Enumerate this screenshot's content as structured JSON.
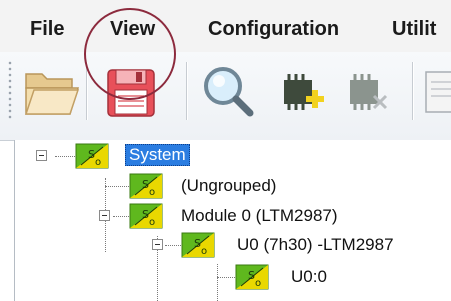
{
  "menu": {
    "file": "File",
    "view": "View",
    "configuration": "Configuration",
    "utilities": "Utilit"
  },
  "tree": {
    "nodes": [
      {
        "label": "System",
        "selected": true
      },
      {
        "label": "(Ungrouped)"
      },
      {
        "label": "Module 0 (LTM2987)"
      },
      {
        "label": "U0 (7h30) -LTM2987"
      },
      {
        "label": "U0:0"
      }
    ]
  },
  "colors": {
    "highlight_ring": "#8c2a3d",
    "selection": "#2b7de1",
    "node_icon_green": "#5fb81e",
    "node_icon_yellow": "#e9d800"
  },
  "icons": {
    "open": "folder-open-icon",
    "save": "floppy-save-icon",
    "search": "magnifier-icon",
    "add_device": "chip-add-icon",
    "remove_device": "chip-remove-icon",
    "page": "document-icon",
    "node": "power-module-icon"
  }
}
